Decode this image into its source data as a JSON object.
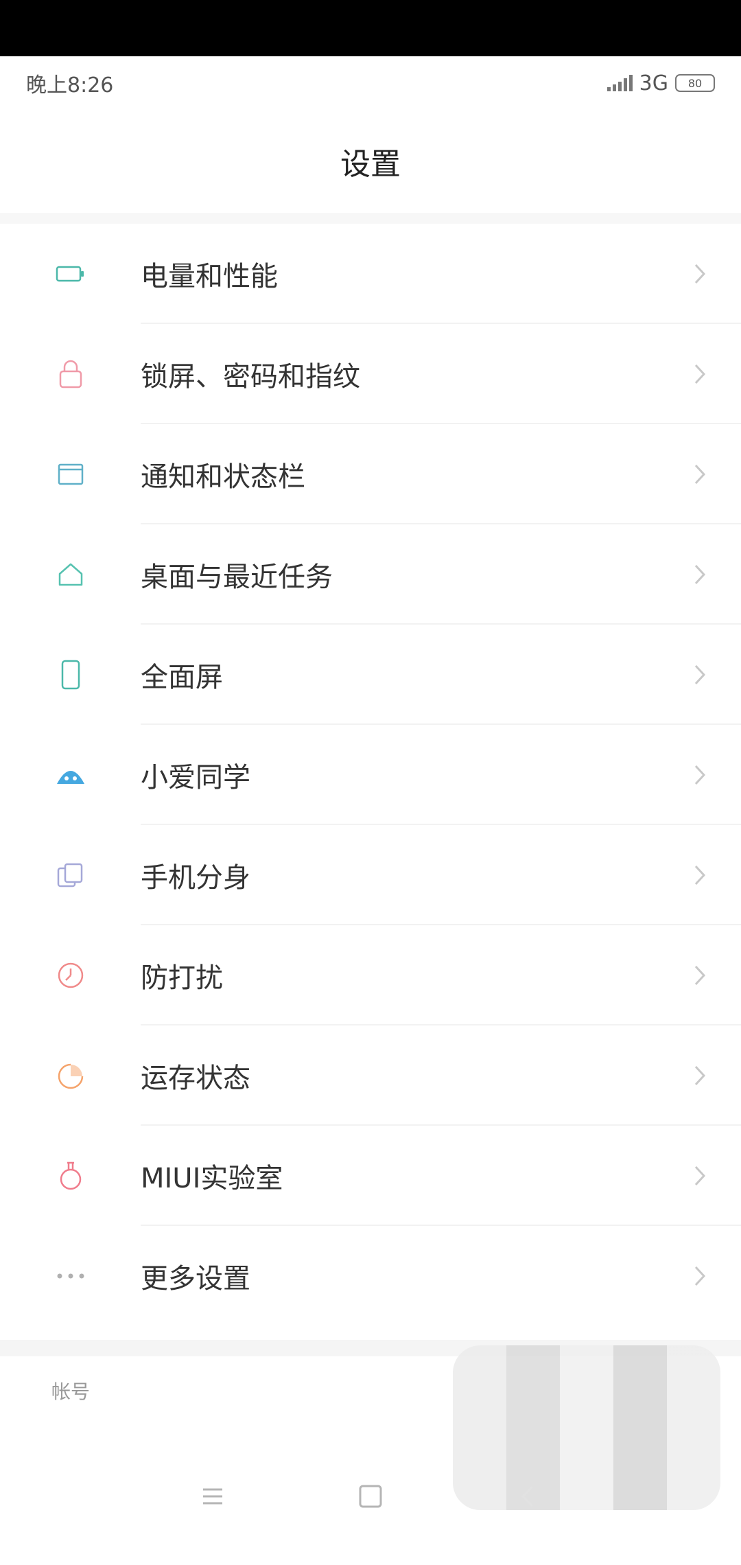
{
  "status_bar": {
    "time": "晚上8:26",
    "network": "3G",
    "battery": "80"
  },
  "header": {
    "title": "设置"
  },
  "settings": {
    "items": [
      {
        "label": "电量和性能",
        "icon": "battery-icon",
        "color": "#4bb8a9"
      },
      {
        "label": "锁屏、密码和指纹",
        "icon": "lock-icon",
        "color": "#f09aa8"
      },
      {
        "label": "通知和状态栏",
        "icon": "notification-icon",
        "color": "#5fb0c8"
      },
      {
        "label": "桌面与最近任务",
        "icon": "home-icon",
        "color": "#56c2b0"
      },
      {
        "label": "全面屏",
        "icon": "phone-icon",
        "color": "#4bb8a9"
      },
      {
        "label": "小爱同学",
        "icon": "assistant-icon",
        "color": "#45a8e0"
      },
      {
        "label": "手机分身",
        "icon": "clone-icon",
        "color": "#a5a8d8"
      },
      {
        "label": "防打扰",
        "icon": "clock-icon",
        "color": "#f08a8a"
      },
      {
        "label": "运存状态",
        "icon": "memory-icon",
        "color": "#f5a36b"
      },
      {
        "label": "MIUI实验室",
        "icon": "flask-icon",
        "color": "#f07c8c"
      },
      {
        "label": "更多设置",
        "icon": "more-icon",
        "color": "#b0b0b0"
      }
    ]
  },
  "account": {
    "label": "帐号"
  }
}
